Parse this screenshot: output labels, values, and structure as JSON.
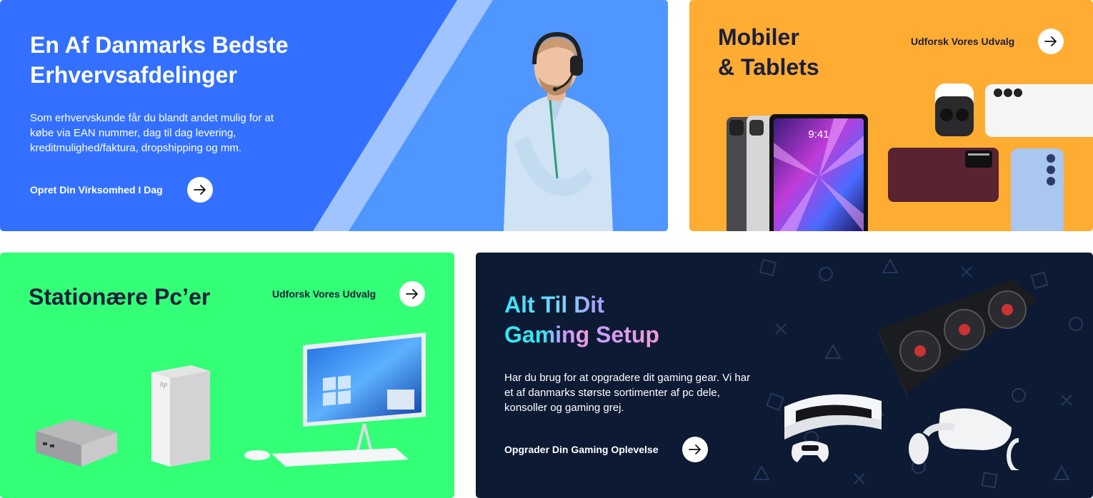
{
  "business": {
    "title_line1": "En Af Danmarks Bedste",
    "title_line2": "Erhvervsafdelinger",
    "description": "Som erhvervskunde får du blandt andet mulig for at\nkøbe via EAN nummer, dag til dag levering,\nkreditmulighed/faktura, dropshipping og mm.",
    "cta_label": "Opret Din Virksomhed I Dag",
    "bg_color": "#3370ff"
  },
  "mobile": {
    "title_line1": "Mobiler",
    "title_line2": "& Tablets",
    "cta_label": "Udforsk Vores Udvalg",
    "tablet_time": "9:41",
    "bg_color": "#ffac33"
  },
  "desktop": {
    "title": "Stationære Pc’er",
    "cta_label": "Udforsk Vores Udvalg",
    "bg_color": "#33ff77"
  },
  "gaming": {
    "title_line1_part1": "Alt Til Dit",
    "title_line2_part1": "Gaming",
    "title_line2_part2": "Setup",
    "description": "Har du brug for at opgradere dit gaming gear. Vi har\net af danmarks største sortimenter af pc dele,\nkonsoller og gaming grej.",
    "cta_label": "Opgrader Din Gaming Oplevelse",
    "bg_color": "#0d1a33"
  },
  "icons": {
    "arrow": "arrow-right-icon"
  }
}
